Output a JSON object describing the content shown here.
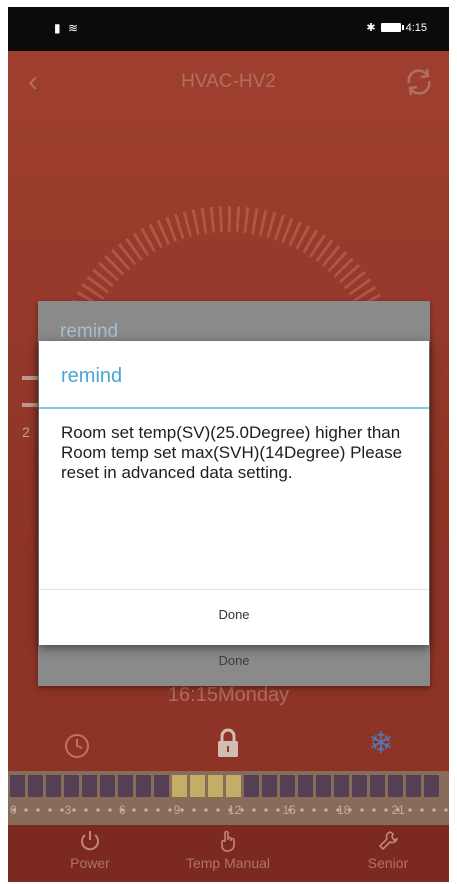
{
  "status_bar": {
    "left_icons": [
      "sim-icon",
      "wifi-icon"
    ],
    "right_icons": [
      "bluetooth-icon",
      "battery-icon"
    ],
    "time": "4:15"
  },
  "header": {
    "title": "HVAC-HV2",
    "back_icon": "chevron-left-icon",
    "refresh_icon": "refresh-icon"
  },
  "background_dialog": {
    "title": "remind",
    "done_label": "Done"
  },
  "left_digit": "2",
  "dialog": {
    "title": "remind",
    "message": "Room set temp(SV)(25.0Degree) higher than Room temp set max(SVH)(14Degree) Please reset in advanced data setting.",
    "done_label": "Done"
  },
  "clock": {
    "text": "16:15Monday"
  },
  "controls": {
    "icons": [
      "clock-icon",
      "lock-icon",
      "snowflake-icon"
    ]
  },
  "schedule": {
    "tick_labels": [
      "0",
      "3",
      "6",
      "9",
      "12",
      "15",
      "18",
      "21"
    ],
    "highlight_slots": [
      9,
      10,
      11,
      12
    ]
  },
  "nav": {
    "items": [
      {
        "label": "Power",
        "icon": "power-icon"
      },
      {
        "label": "Temp Manual",
        "icon": "hand-icon"
      },
      {
        "label": "Senior",
        "icon": "wrench-icon"
      }
    ]
  },
  "colors": {
    "background": "#a8412f",
    "accent": "#49a7d6",
    "nav": "#8a2f24"
  }
}
